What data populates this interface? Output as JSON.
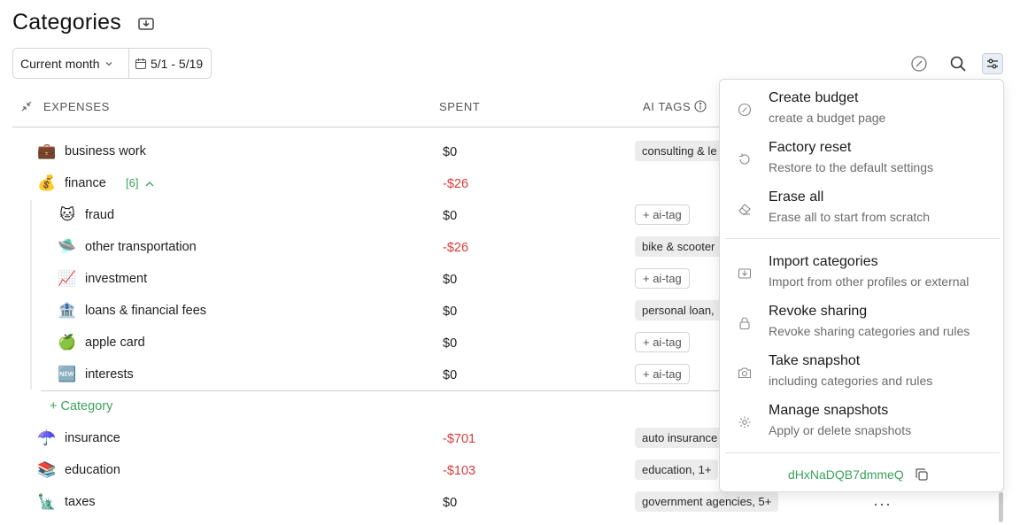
{
  "page": {
    "title": "Categories",
    "period_label": "Current month",
    "date_range": "5/1 - 5/19"
  },
  "table": {
    "col_expenses": "EXPENSES",
    "col_spent": "SPENT",
    "col_ai_tags": "AI TAGS",
    "add_category_label": "+ Category",
    "rows": [
      {
        "emoji": "💼",
        "name": "business work",
        "amount": "$0",
        "tag": "consulting & le"
      },
      {
        "emoji": "💰",
        "name": "finance",
        "count": "[6]",
        "amount": "-$26"
      },
      {
        "emoji": "🐱",
        "name": "fraud",
        "amount": "$0",
        "tag": "+ ai-tag"
      },
      {
        "emoji": "🛸",
        "name": "other transportation",
        "amount": "-$26",
        "tag": "bike & scooter"
      },
      {
        "emoji": "📈",
        "name": "investment",
        "amount": "$0",
        "tag": "+ ai-tag"
      },
      {
        "emoji": "🏦",
        "name": "loans & financial fees",
        "amount": "$0",
        "tag": "personal loan,"
      },
      {
        "emoji": "🍏",
        "name": "apple card",
        "amount": "$0",
        "tag": "+ ai-tag"
      },
      {
        "emoji": "🆕",
        "name": "interests",
        "amount": "$0",
        "tag": "+ ai-tag"
      },
      {
        "emoji": "☂️",
        "name": "insurance",
        "amount": "-$701",
        "tag": "auto insurance"
      },
      {
        "emoji": "📚",
        "name": "education",
        "amount": "-$103",
        "tag": "education, 1+"
      },
      {
        "emoji": "🗽",
        "name": "taxes",
        "amount": "$0",
        "tag": "government agencies, 5+"
      }
    ]
  },
  "menu": {
    "items": [
      {
        "title": "Create budget",
        "subtitle": "create a budget page",
        "icon": "budget-icon"
      },
      {
        "title": "Factory reset",
        "subtitle": "Restore to the default settings",
        "icon": "reset-icon"
      },
      {
        "title": "Erase all",
        "subtitle": "Erase all to start from scratch",
        "icon": "eraser-icon"
      },
      {
        "title": "Import categories",
        "subtitle": "Import from other profiles or external",
        "icon": "import-icon"
      },
      {
        "title": "Revoke sharing",
        "subtitle": "Revoke sharing categories and rules",
        "icon": "lock-icon"
      },
      {
        "title": "Take snapshot",
        "subtitle": "including categories and rules",
        "icon": "camera-icon"
      },
      {
        "title": "Manage snapshots",
        "subtitle": "Apply or delete snapshots",
        "icon": "gear-icon"
      }
    ],
    "token": "dHxNaDQB7dmmeQ"
  },
  "colors": {
    "positive_accent": "#3aa35b",
    "negative": "#d63b3b"
  },
  "more_label": "···"
}
